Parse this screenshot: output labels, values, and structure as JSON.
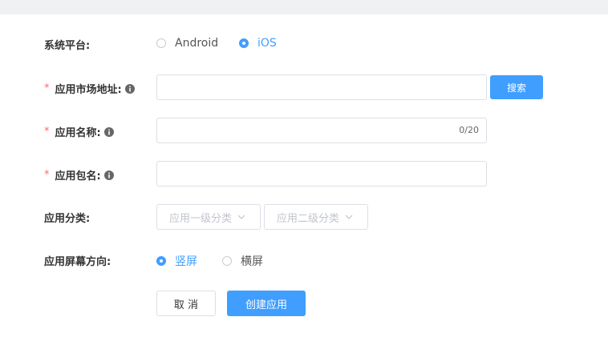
{
  "form": {
    "platform": {
      "label": "系统平台:",
      "options": [
        {
          "label": "Android",
          "checked": false
        },
        {
          "label": "iOS",
          "checked": true
        }
      ]
    },
    "market_url": {
      "label": "应用市场地址:",
      "required_mark": "*",
      "value": "",
      "search_label": "搜索"
    },
    "app_name": {
      "label": "应用名称:",
      "required_mark": "*",
      "value": "",
      "counter": "0/20"
    },
    "package_name": {
      "label": "应用包名:",
      "required_mark": "*",
      "value": ""
    },
    "category": {
      "label": "应用分类:",
      "primary_placeholder": "应用一级分类",
      "secondary_placeholder": "应用二级分类"
    },
    "orientation": {
      "label": "应用屏幕方向:",
      "options": [
        {
          "label": "竖屏",
          "checked": true
        },
        {
          "label": "横屏",
          "checked": false
        }
      ]
    },
    "actions": {
      "cancel_label": "取 消",
      "create_label": "创建应用"
    }
  },
  "colors": {
    "primary": "#409eff",
    "required": "#f56c6c",
    "border": "#dcdfe6",
    "placeholder": "#c0c4cc"
  },
  "icons": {
    "info": "info-circle-icon",
    "chevron": "chevron-down-icon"
  }
}
